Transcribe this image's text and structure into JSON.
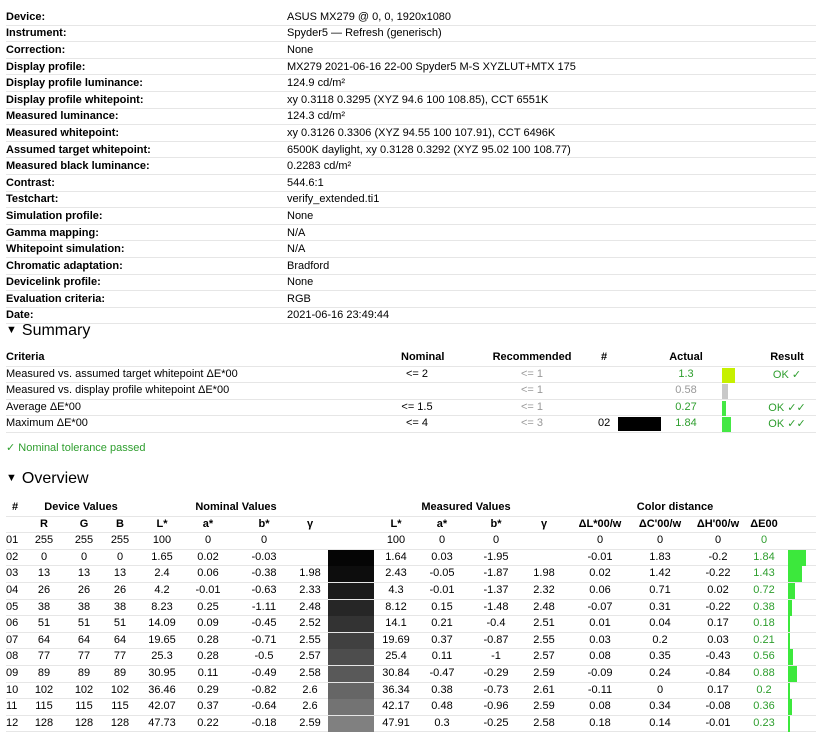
{
  "info": [
    {
      "label": "Device:",
      "value": "ASUS MX279 @ 0, 0, 1920x1080"
    },
    {
      "label": "Instrument:",
      "value": "Spyder5 — Refresh (generisch)"
    },
    {
      "label": "Correction:",
      "value": "None"
    },
    {
      "label": "Display profile:",
      "value": "MX279 2021-06-16 22-00 Spyder5 M-S XYZLUT+MTX 175"
    },
    {
      "label": "Display profile luminance:",
      "value": "124.9 cd/m²"
    },
    {
      "label": "Display profile whitepoint:",
      "value": "xy 0.3118 0.3295 (XYZ 94.6 100 108.85), CCT 6551K"
    },
    {
      "label": "Measured luminance:",
      "value": "124.3 cd/m²"
    },
    {
      "label": "Measured whitepoint:",
      "value": "xy 0.3126 0.3306 (XYZ 94.55 100 107.91), CCT 6496K"
    },
    {
      "label": "Assumed target whitepoint:",
      "value": "6500K daylight, xy 0.3128 0.3292 (XYZ 95.02 100 108.77)"
    },
    {
      "label": "Measured black luminance:",
      "value": "0.2283 cd/m²"
    },
    {
      "label": "Contrast:",
      "value": "544.6:1"
    },
    {
      "label": "Testchart:",
      "value": "verify_extended.ti1"
    },
    {
      "label": "Simulation profile:",
      "value": "None"
    },
    {
      "label": "Gamma mapping:",
      "value": "N/A"
    },
    {
      "label": "Whitepoint simulation:",
      "value": "N/A"
    },
    {
      "label": "Chromatic adaptation:",
      "value": "Bradford"
    },
    {
      "label": "Devicelink profile:",
      "value": "None"
    },
    {
      "label": "Evaluation criteria:",
      "value": "RGB"
    },
    {
      "label": "Date:",
      "value": "2021-06-16 23:49:44"
    }
  ],
  "summary": {
    "title": "Summary",
    "toggle": "▼",
    "headers": {
      "criteria": "Criteria",
      "nominal": "Nominal",
      "recommended": "Recommended",
      "num": "#",
      "actual": "Actual",
      "result": "Result"
    },
    "rows": [
      {
        "criteria": "Measured vs. assumed target whitepoint ΔE*00",
        "nominal": "<= 2",
        "recommended": "<= 1",
        "num": "",
        "actual": "1.3",
        "actual_ratio": 0.65,
        "bar_color": "#c6f000",
        "result": "OK ✓",
        "grey": false,
        "swatch": false
      },
      {
        "criteria": "Measured vs. display profile whitepoint ΔE*00",
        "nominal": "",
        "recommended": "<= 1",
        "num": "",
        "actual": "0.58",
        "actual_ratio": 0.29,
        "bar_color": "#c8c8c8",
        "result": "",
        "grey": true,
        "swatch": false
      },
      {
        "criteria": "Average ΔE*00",
        "nominal": "<= 1.5",
        "recommended": "<= 1",
        "num": "",
        "actual": "0.27",
        "actual_ratio": 0.18,
        "bar_color": "#44e844",
        "result": "OK ✓✓",
        "grey": false,
        "swatch": false
      },
      {
        "criteria": "Maximum ΔE*00",
        "nominal": "<= 4",
        "recommended": "<= 3",
        "num": "02",
        "actual": "1.84",
        "actual_ratio": 0.46,
        "bar_color": "#44e844",
        "result": "OK ✓✓",
        "grey": false,
        "swatch": true
      }
    ],
    "passed": "✓ Nominal tolerance passed"
  },
  "overview": {
    "title": "Overview",
    "toggle": "▼",
    "groups": {
      "idx": "#",
      "device": "Device Values",
      "nominal": "Nominal Values",
      "measured": "Measured Values",
      "distance": "Color distance"
    },
    "columns": {
      "R": "R",
      "G": "G",
      "B": "B",
      "L": "L*",
      "a": "a*",
      "b": "b*",
      "gamma": "γ",
      "dL": "ΔL*00/w",
      "dC": "ΔC'00/w",
      "dH": "ΔH'00/w",
      "dE": "ΔE00"
    },
    "rows": [
      {
        "idx": "01",
        "r": "255",
        "g": "255",
        "b": "255",
        "nL": "100",
        "na": "0",
        "nb": "0",
        "ng": "",
        "mL": "100",
        "ma": "0",
        "mb": "0",
        "mg": "",
        "dL": "0",
        "dC": "0",
        "dH": "0",
        "dE": "0",
        "de_value": 0,
        "gray": "#ffffff"
      },
      {
        "idx": "02",
        "r": "0",
        "g": "0",
        "b": "0",
        "nL": "1.65",
        "na": "0.02",
        "nb": "-0.03",
        "ng": "",
        "mL": "1.64",
        "ma": "0.03",
        "mb": "-1.95",
        "mg": "",
        "dL": "-0.01",
        "dC": "1.83",
        "dH": "-0.2",
        "dE": "1.84",
        "de_value": 1.84,
        "gray": "#050505"
      },
      {
        "idx": "03",
        "r": "13",
        "g": "13",
        "b": "13",
        "nL": "2.4",
        "na": "0.06",
        "nb": "-0.38",
        "ng": "1.98",
        "mL": "2.43",
        "ma": "-0.05",
        "mb": "-1.87",
        "mg": "1.98",
        "dL": "0.02",
        "dC": "1.42",
        "dH": "-0.22",
        "dE": "1.43",
        "de_value": 1.43,
        "gray": "#0d0d0d"
      },
      {
        "idx": "04",
        "r": "26",
        "g": "26",
        "b": "26",
        "nL": "4.2",
        "na": "-0.01",
        "nb": "-0.63",
        "ng": "2.33",
        "mL": "4.3",
        "ma": "-0.01",
        "mb": "-1.37",
        "mg": "2.32",
        "dL": "0.06",
        "dC": "0.71",
        "dH": "0.02",
        "dE": "0.72",
        "de_value": 0.72,
        "gray": "#1a1a1a"
      },
      {
        "idx": "05",
        "r": "38",
        "g": "38",
        "b": "38",
        "nL": "8.23",
        "na": "0.25",
        "nb": "-1.11",
        "ng": "2.48",
        "mL": "8.12",
        "ma": "0.15",
        "mb": "-1.48",
        "mg": "2.48",
        "dL": "-0.07",
        "dC": "0.31",
        "dH": "-0.22",
        "dE": "0.38",
        "de_value": 0.38,
        "gray": "#262626"
      },
      {
        "idx": "06",
        "r": "51",
        "g": "51",
        "b": "51",
        "nL": "14.09",
        "na": "0.09",
        "nb": "-0.45",
        "ng": "2.52",
        "mL": "14.1",
        "ma": "0.21",
        "mb": "-0.4",
        "mg": "2.51",
        "dL": "0.01",
        "dC": "0.04",
        "dH": "0.17",
        "dE": "0.18",
        "de_value": 0.18,
        "gray": "#333333"
      },
      {
        "idx": "07",
        "r": "64",
        "g": "64",
        "b": "64",
        "nL": "19.65",
        "na": "0.28",
        "nb": "-0.71",
        "ng": "2.55",
        "mL": "19.69",
        "ma": "0.37",
        "mb": "-0.87",
        "mg": "2.55",
        "dL": "0.03",
        "dC": "0.2",
        "dH": "0.03",
        "dE": "0.21",
        "de_value": 0.21,
        "gray": "#404040"
      },
      {
        "idx": "08",
        "r": "77",
        "g": "77",
        "b": "77",
        "nL": "25.3",
        "na": "0.28",
        "nb": "-0.5",
        "ng": "2.57",
        "mL": "25.4",
        "ma": "0.11",
        "mb": "-1",
        "mg": "2.57",
        "dL": "0.08",
        "dC": "0.35",
        "dH": "-0.43",
        "dE": "0.56",
        "de_value": 0.56,
        "gray": "#4d4d4d"
      },
      {
        "idx": "09",
        "r": "89",
        "g": "89",
        "b": "89",
        "nL": "30.95",
        "na": "0.11",
        "nb": "-0.49",
        "ng": "2.58",
        "mL": "30.84",
        "ma": "-0.47",
        "mb": "-0.29",
        "mg": "2.59",
        "dL": "-0.09",
        "dC": "0.24",
        "dH": "-0.84",
        "dE": "0.88",
        "de_value": 0.88,
        "gray": "#595959"
      },
      {
        "idx": "10",
        "r": "102",
        "g": "102",
        "b": "102",
        "nL": "36.46",
        "na": "0.29",
        "nb": "-0.82",
        "ng": "2.6",
        "mL": "36.34",
        "ma": "0.38",
        "mb": "-0.73",
        "mg": "2.61",
        "dL": "-0.11",
        "dC": "0",
        "dH": "0.17",
        "dE": "0.2",
        "de_value": 0.2,
        "gray": "#666666"
      },
      {
        "idx": "11",
        "r": "115",
        "g": "115",
        "b": "115",
        "nL": "42.07",
        "na": "0.37",
        "nb": "-0.64",
        "ng": "2.6",
        "mL": "42.17",
        "ma": "0.48",
        "mb": "-0.96",
        "mg": "2.59",
        "dL": "0.08",
        "dC": "0.34",
        "dH": "-0.08",
        "dE": "0.36",
        "de_value": 0.36,
        "gray": "#737373"
      },
      {
        "idx": "12",
        "r": "128",
        "g": "128",
        "b": "128",
        "nL": "47.73",
        "na": "0.22",
        "nb": "-0.18",
        "ng": "2.59",
        "mL": "47.91",
        "ma": "0.3",
        "mb": "-0.25",
        "mg": "2.58",
        "dL": "0.18",
        "dC": "0.14",
        "dH": "-0.01",
        "dE": "0.23",
        "de_value": 0.23,
        "gray": "#808080"
      }
    ]
  }
}
